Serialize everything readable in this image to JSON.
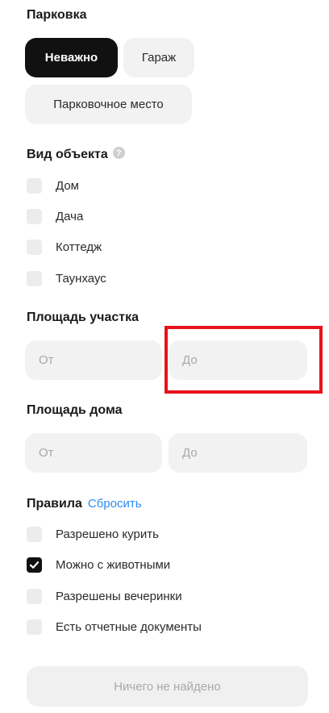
{
  "parking": {
    "title": "Парковка",
    "options": [
      {
        "label": "Неважно",
        "active": true
      },
      {
        "label": "Гараж",
        "active": false
      },
      {
        "label": "Парковочное место",
        "active": false
      }
    ]
  },
  "object_type": {
    "title": "Вид объекта",
    "help_icon": "?",
    "options": [
      {
        "label": "Дом",
        "checked": false
      },
      {
        "label": "Дача",
        "checked": false
      },
      {
        "label": "Коттедж",
        "checked": false
      },
      {
        "label": "Таунхаус",
        "checked": false
      }
    ]
  },
  "plot_area": {
    "title": "Площадь участка",
    "from_placeholder": "От",
    "to_placeholder": "До"
  },
  "house_area": {
    "title": "Площадь дома",
    "from_placeholder": "От",
    "to_placeholder": "До"
  },
  "rules": {
    "title": "Правила",
    "reset_label": "Сбросить",
    "options": [
      {
        "label": "Разрешено курить",
        "checked": false
      },
      {
        "label": "Можно с животными",
        "checked": true
      },
      {
        "label": "Разрешены вечеринки",
        "checked": false
      },
      {
        "label": "Есть отчетные документы",
        "checked": false
      }
    ]
  },
  "submit": {
    "label": "Ничего не найдено"
  },
  "colors": {
    "accent_link": "#2d8cf0",
    "highlight": "#e8121b",
    "active_chip": "#111111"
  }
}
